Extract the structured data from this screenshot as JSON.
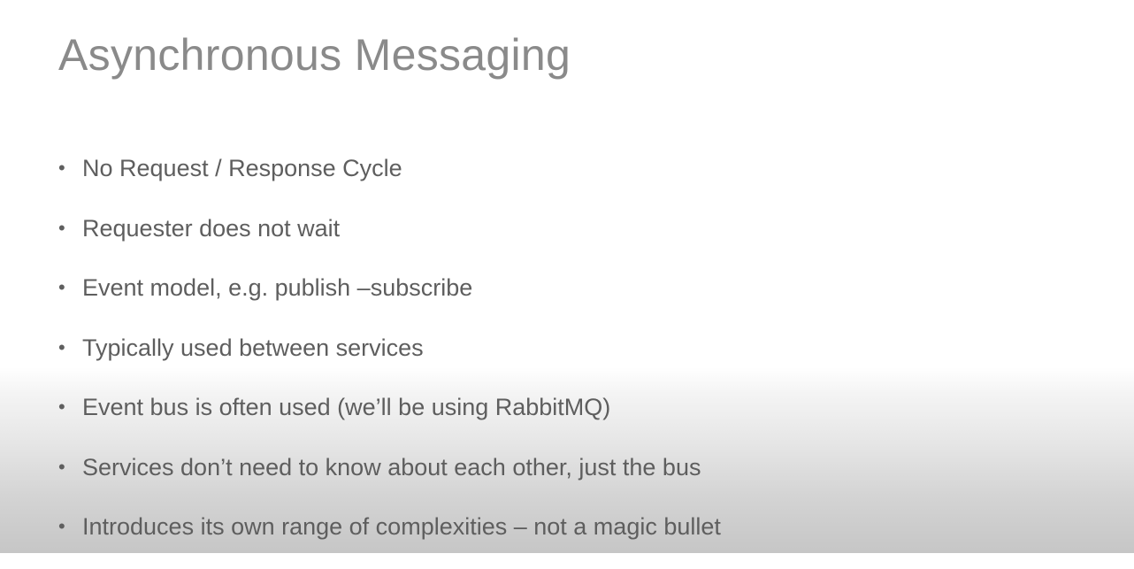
{
  "slide": {
    "title": "Asynchronous Messaging",
    "bullet_glyph": "•",
    "bullets": [
      "No Request / Response Cycle",
      "Requester does not wait",
      "Event model, e.g. publish –subscribe",
      "Typically used between services",
      "Event bus is often used (we’ll be using RabbitMQ)",
      "Services don’t need to know about each other, just the bus",
      "Introduces its own range of complexities – not a magic bullet"
    ]
  }
}
